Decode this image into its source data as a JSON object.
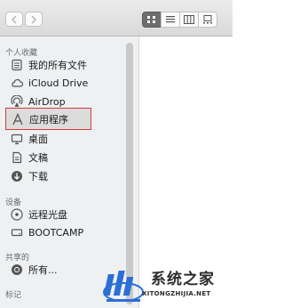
{
  "toolbar": {
    "back_icon": "chevron-left-icon",
    "forward_icon": "chevron-right-icon",
    "views": [
      "icon-view",
      "list-view",
      "column-view",
      "gallery-view"
    ]
  },
  "sidebar": {
    "favorites_header": "个人收藏",
    "favorites": [
      {
        "label": "我的所有文件",
        "icon": "all-files-icon"
      },
      {
        "label": "iCloud Drive",
        "icon": "cloud-icon"
      },
      {
        "label": "AirDrop",
        "icon": "airdrop-icon"
      },
      {
        "label": "应用程序",
        "icon": "applications-icon",
        "selected": true
      },
      {
        "label": "桌面",
        "icon": "desktop-icon"
      },
      {
        "label": "文稿",
        "icon": "documents-icon"
      },
      {
        "label": "下载",
        "icon": "downloads-icon"
      }
    ],
    "devices_header": "设备",
    "devices": [
      {
        "label": "远程光盘",
        "icon": "disc-icon"
      },
      {
        "label": "BOOTCAMP",
        "icon": "drive-icon"
      }
    ],
    "shared_header": "共享的",
    "shared": [
      {
        "label": "所有...",
        "icon": "network-icon"
      }
    ],
    "tags_header": "标记",
    "selection_color": "#d33a3a"
  },
  "watermark": {
    "title": "系统之家",
    "url": "XITONGZHIJIA.NET"
  }
}
